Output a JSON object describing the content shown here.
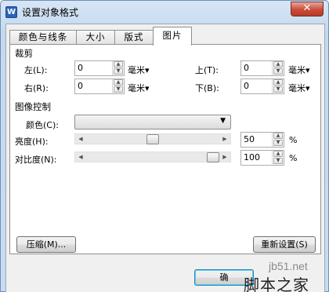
{
  "window": {
    "title": "设置对象格式",
    "app_icon_letter": "W",
    "close_glyph": "✕"
  },
  "tabs": [
    {
      "label": "颜色与线条",
      "active": false
    },
    {
      "label": "大小",
      "active": false
    },
    {
      "label": "版式",
      "active": false
    },
    {
      "label": "图片",
      "active": true
    }
  ],
  "crop": {
    "title": "裁剪",
    "left": {
      "label": "左(L):",
      "value": "0",
      "unit": "毫米▾"
    },
    "right": {
      "label": "右(R):",
      "value": "0",
      "unit": "毫米▾"
    },
    "top": {
      "label": "上(T):",
      "value": "0",
      "unit": "毫米▾"
    },
    "bottom": {
      "label": "下(B):",
      "value": "0",
      "unit": "毫米▾"
    }
  },
  "image_control": {
    "title": "图像控制",
    "color": {
      "label": "颜色(C):",
      "value": ""
    },
    "brightness": {
      "label": "亮度(H):",
      "value": "50",
      "unit": "%",
      "level": 0.5
    },
    "contrast": {
      "label": "对比度(N):",
      "value": "100",
      "unit": "%",
      "level": 1.0
    }
  },
  "buttons": {
    "compress": "压缩(M)...",
    "reset": "重新设置(S)",
    "ok": "确"
  },
  "spin_glyphs": {
    "up": "▲",
    "down": "▼",
    "caret": "▼",
    "left": "◀",
    "right": "▶"
  },
  "watermark": {
    "site": "jb51.net",
    "brand": "脚本之家"
  },
  "colors": {
    "title_bar": "#c9dcef",
    "close_button": "#c94b38",
    "default_button_border": "#3c7fb1"
  }
}
